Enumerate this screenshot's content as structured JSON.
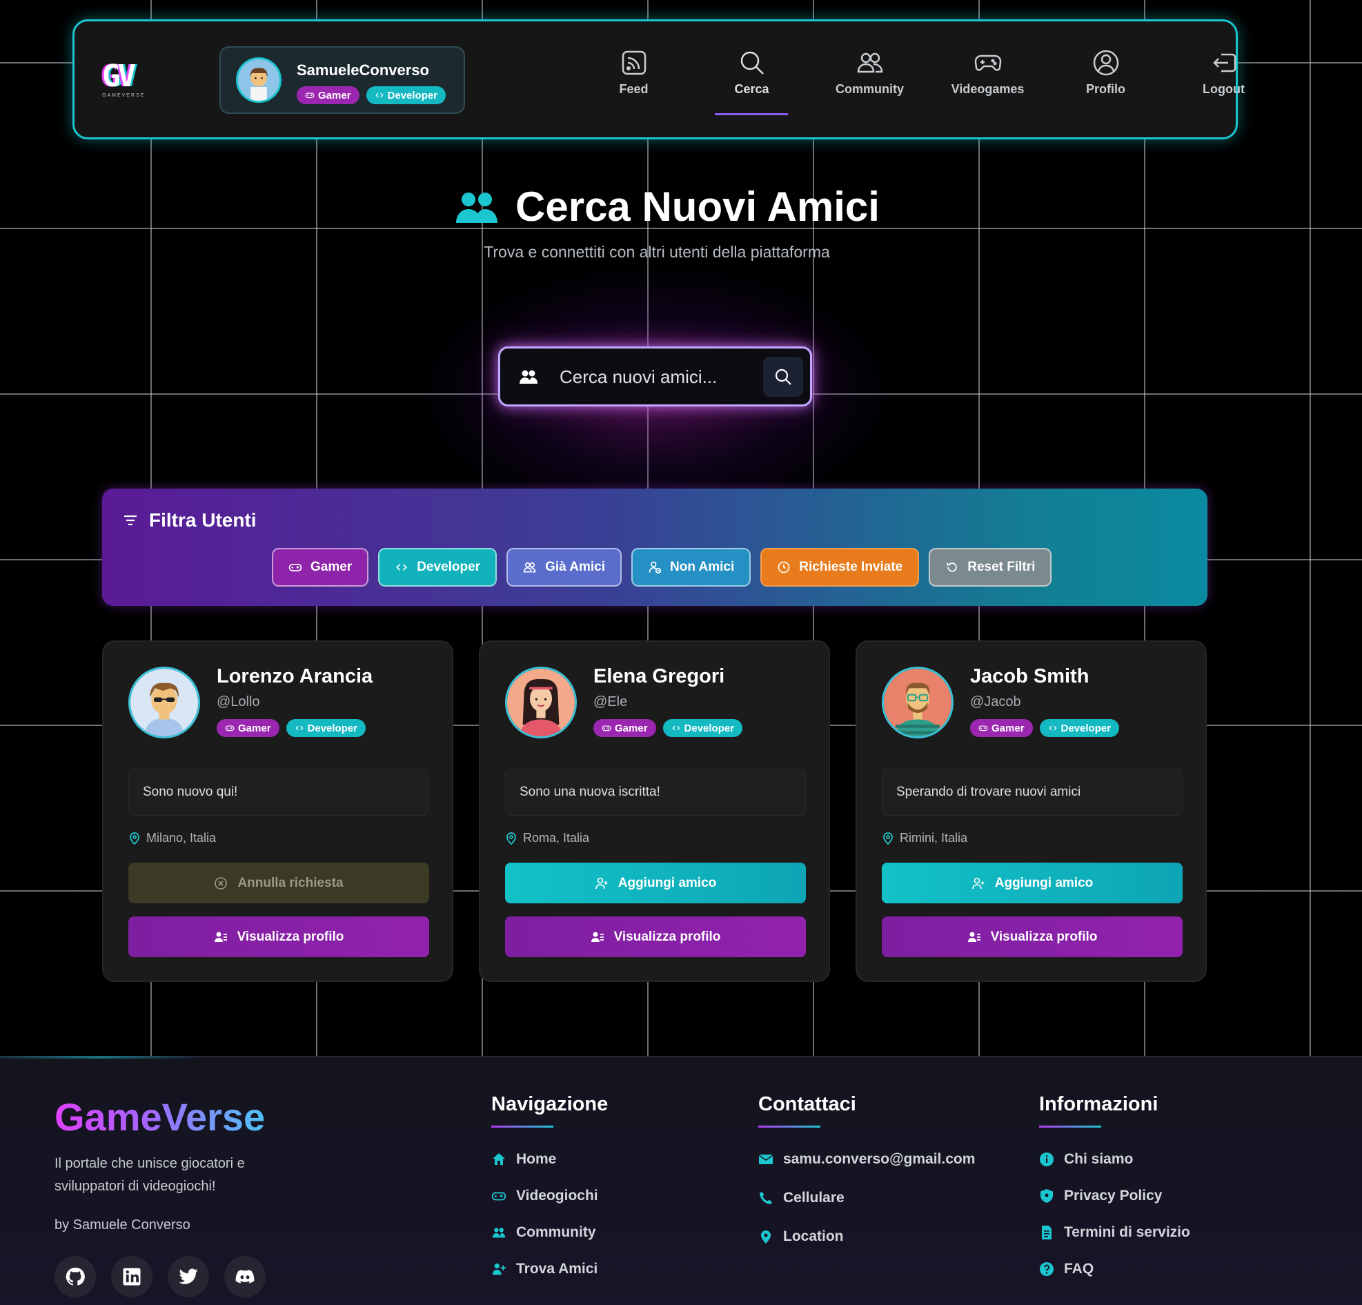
{
  "app": {
    "logo_text": "GV",
    "logo_sub": "GAMEVERSE"
  },
  "user": {
    "name": "SamueleConverso",
    "badges": [
      "Gamer",
      "Developer"
    ]
  },
  "nav": {
    "items": [
      {
        "label": "Feed",
        "icon": "rss-icon"
      },
      {
        "label": "Cerca",
        "icon": "search-icon",
        "active": true
      },
      {
        "label": "Community",
        "icon": "users-icon"
      },
      {
        "label": "Videogames",
        "icon": "gamepad-icon"
      },
      {
        "label": "Profilo",
        "icon": "user-circle-icon"
      },
      {
        "label": "Logout",
        "icon": "logout-icon"
      }
    ]
  },
  "hero": {
    "title": "Cerca Nuovi Amici",
    "subtitle": "Trova e connettiti con altri utenti della piattaforma"
  },
  "search": {
    "placeholder": "Cerca nuovi amici..."
  },
  "filters": {
    "title": "Filtra Utenti",
    "buttons": [
      "Gamer",
      "Developer",
      "Già Amici",
      "Non Amici",
      "Richieste Inviate",
      "Reset Filtri"
    ]
  },
  "cards": [
    {
      "name": "Lorenzo Arancia",
      "handle": "@Lollo",
      "badges": [
        "Gamer",
        "Developer"
      ],
      "bio": "Sono nuovo qui!",
      "location": "Milano, Italia",
      "primary_action": "Annulla richiesta",
      "secondary_action": "Visualizza profilo"
    },
    {
      "name": "Elena Gregori",
      "handle": "@Ele",
      "badges": [
        "Gamer",
        "Developer"
      ],
      "bio": "Sono una nuova iscritta!",
      "location": "Roma, Italia",
      "primary_action": "Aggiungi amico",
      "secondary_action": "Visualizza profilo"
    },
    {
      "name": "Jacob Smith",
      "handle": "@Jacob",
      "badges": [
        "Gamer",
        "Developer"
      ],
      "bio": "Sperando di trovare nuovi amici",
      "location": "Rimini, Italia",
      "primary_action": "Aggiungi amico",
      "secondary_action": "Visualizza profilo"
    }
  ],
  "footer": {
    "brand": "GameVerse",
    "description": "Il portale che unisce giocatori e sviluppatori di videogiochi!",
    "by": "by Samuele Converso",
    "socials": [
      "github-icon",
      "linkedin-icon",
      "twitter-icon",
      "discord-icon"
    ],
    "navigation": {
      "title": "Navigazione",
      "items": [
        "Home",
        "Videogiochi",
        "Community",
        "Trova Amici"
      ]
    },
    "contact": {
      "title": "Contattaci",
      "items": [
        "samu.converso@gmail.com",
        "Cellulare",
        "Location"
      ]
    },
    "info": {
      "title": "Informazioni",
      "items": [
        "Chi siamo",
        "Privacy Policy",
        "Termini di servizio",
        "FAQ"
      ]
    }
  },
  "colors": {
    "accent_cyan": "#1bc6cf",
    "accent_purple": "#9b27b0",
    "orange": "#e87c1c"
  }
}
